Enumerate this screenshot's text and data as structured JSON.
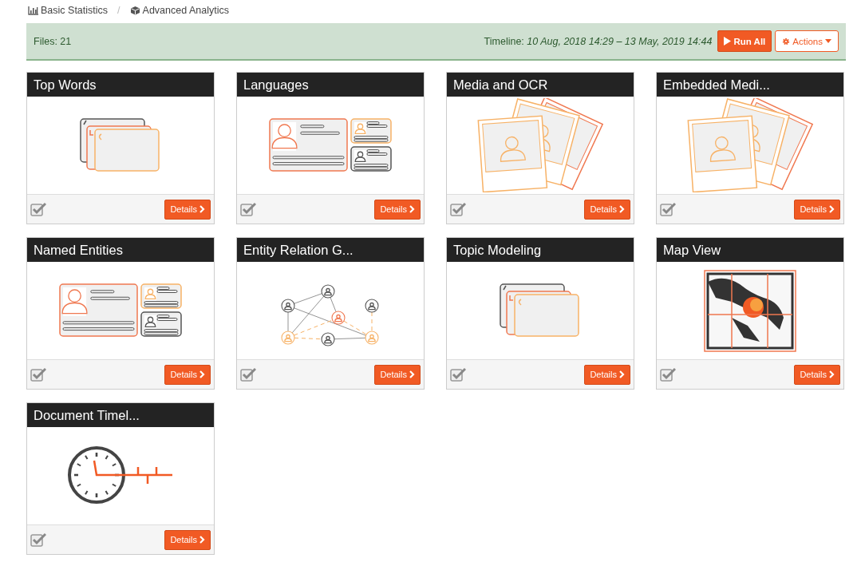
{
  "breadcrumb": {
    "items": [
      {
        "label": "Basic Statistics"
      },
      {
        "label": "Advanced Analytics"
      }
    ],
    "separator": "/"
  },
  "toolbar": {
    "files": "Files: 21",
    "timeline": "Timeline: *10 Aug, 2018 14:29 – 13 May, 2019 14:44*",
    "run_button": "Run All",
    "actions_button": "Actions"
  },
  "cards": [
    {
      "title": "Top Words",
      "kind": "letters",
      "checked": true,
      "button": "Details"
    },
    {
      "title": "Languages",
      "kind": "idcards",
      "checked": true,
      "button": "Details"
    },
    {
      "title": "Media and OCR",
      "kind": "photos",
      "checked": true,
      "button": "Details"
    },
    {
      "title": "Embedded Medi...",
      "kind": "photos",
      "checked": true,
      "button": "Details"
    },
    {
      "title": "Named Entities",
      "kind": "idcards",
      "checked": true,
      "button": "Details"
    },
    {
      "title": "Entity Relation G...",
      "kind": "network",
      "checked": true,
      "button": "Details"
    },
    {
      "title": "Topic Modeling",
      "kind": "letters",
      "checked": true,
      "button": "Details"
    },
    {
      "title": "Map View",
      "kind": "map",
      "checked": true,
      "button": "Details"
    },
    {
      "title": "Document Timel...",
      "kind": "clock",
      "checked": true,
      "button": "Details"
    }
  ]
}
